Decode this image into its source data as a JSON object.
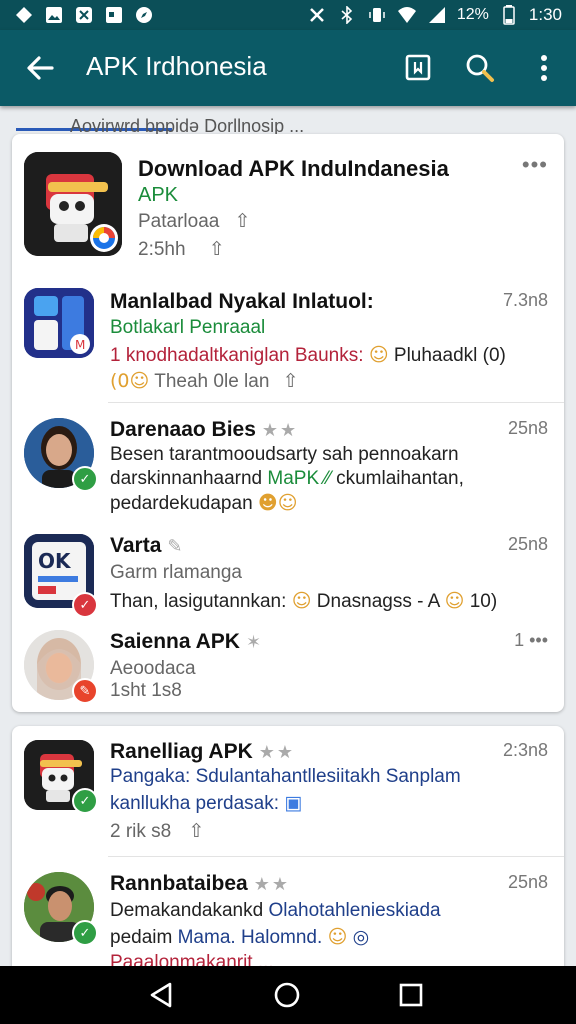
{
  "status": {
    "battery": "12%",
    "time": "1:30"
  },
  "appbar": {
    "title": "APK Irdhonesia"
  },
  "peek_text": "Aovirwrd bppidə Dorllnosip ...",
  "card1": {
    "header": {
      "title": "Download APK InduIndanesia",
      "subtitle": "APK",
      "line1": "Patarloaa",
      "line2": "2:5hh",
      "more": "•••"
    },
    "items": [
      {
        "name": "Manlalbad Nyakal Inlatuol:",
        "time": "7.3n8",
        "line1": "Botlakarl Penraaal",
        "line2a": "1 knodhadaltkaniglan Baunks:",
        "line2b": "Pluhaadkl",
        "line3": "Theah 0le  lan"
      },
      {
        "name": "Darenaao Bies",
        "time": "25n8",
        "line1": "Besen tarantmooudsarty sah pennoakarn",
        "line2a": "darskinnanhaarnd",
        "line2b": "MaPK",
        "line2c": "ckumlaihantan,",
        "line3": "pedardekudapan"
      },
      {
        "name": "Varta",
        "time": "25n8",
        "line1": "Garm rlamanga",
        "line2a": "Than, lasigutannkan:",
        "line2b": "Dnasnagss - A",
        "line2c": "10)"
      },
      {
        "name": "Saienna APK",
        "time": "1 •••",
        "line1": "Aeoodaca",
        "line2": "1sht  1s8"
      }
    ]
  },
  "card2": {
    "items": [
      {
        "name": "Ranelliag APK",
        "time": "2:3n8",
        "line1": "Pangaka: Sdulantahantllesiitakh Sanplam",
        "line2": "kanllukha perdasak:",
        "line3": "2 rik  s8"
      },
      {
        "name": "Rannbataibea",
        "time": "25n8",
        "line1a": "Demakandakankd",
        "line1b": "Olahotahlenieskiada",
        "line2a": "pedaim",
        "line2b": "Mama. Halomnd.",
        "line3": "Paaalonmakanrit ..."
      }
    ]
  },
  "colors": {
    "statusbar": "#0b4f58",
    "appbar": "#0b5a66",
    "accent_green": "#1a8c3a",
    "accent_blue": "#1f3f8a"
  }
}
